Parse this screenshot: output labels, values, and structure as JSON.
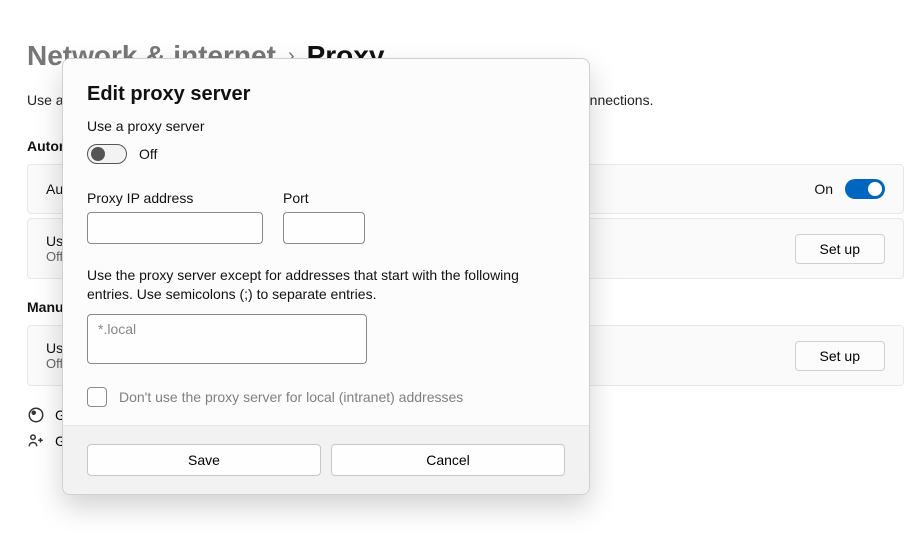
{
  "breadcrumb": {
    "parent": "Network & internet",
    "current": "Proxy"
  },
  "page_description": "Use a proxy server for Ethernet or Wi-Fi connections. These settings don't apply to VPN connections.",
  "sections": {
    "auto": {
      "title": "Automatic proxy setup",
      "rows": [
        {
          "title": "Automatically detect settings",
          "status": "On"
        },
        {
          "title": "Use setup script",
          "sub": "Off",
          "button": "Set up"
        }
      ]
    },
    "manual": {
      "title": "Manual proxy setup",
      "rows": [
        {
          "title": "Use a proxy server",
          "sub": "Off",
          "button": "Set up"
        }
      ]
    }
  },
  "help_links": [
    "Get help",
    "Give feedback"
  ],
  "modal": {
    "title": "Edit proxy server",
    "use_proxy_label": "Use a proxy server",
    "toggle_state": "Off",
    "ip_label": "Proxy IP address",
    "ip_value": "",
    "port_label": "Port",
    "port_value": "",
    "exceptions_text": "Use the proxy server except for addresses that start with the following entries. Use semicolons (;) to separate entries.",
    "exceptions_placeholder": "*.local",
    "exceptions_value": "",
    "bypass_local_label": "Don't use the proxy server for local (intranet) addresses",
    "save_label": "Save",
    "cancel_label": "Cancel"
  }
}
